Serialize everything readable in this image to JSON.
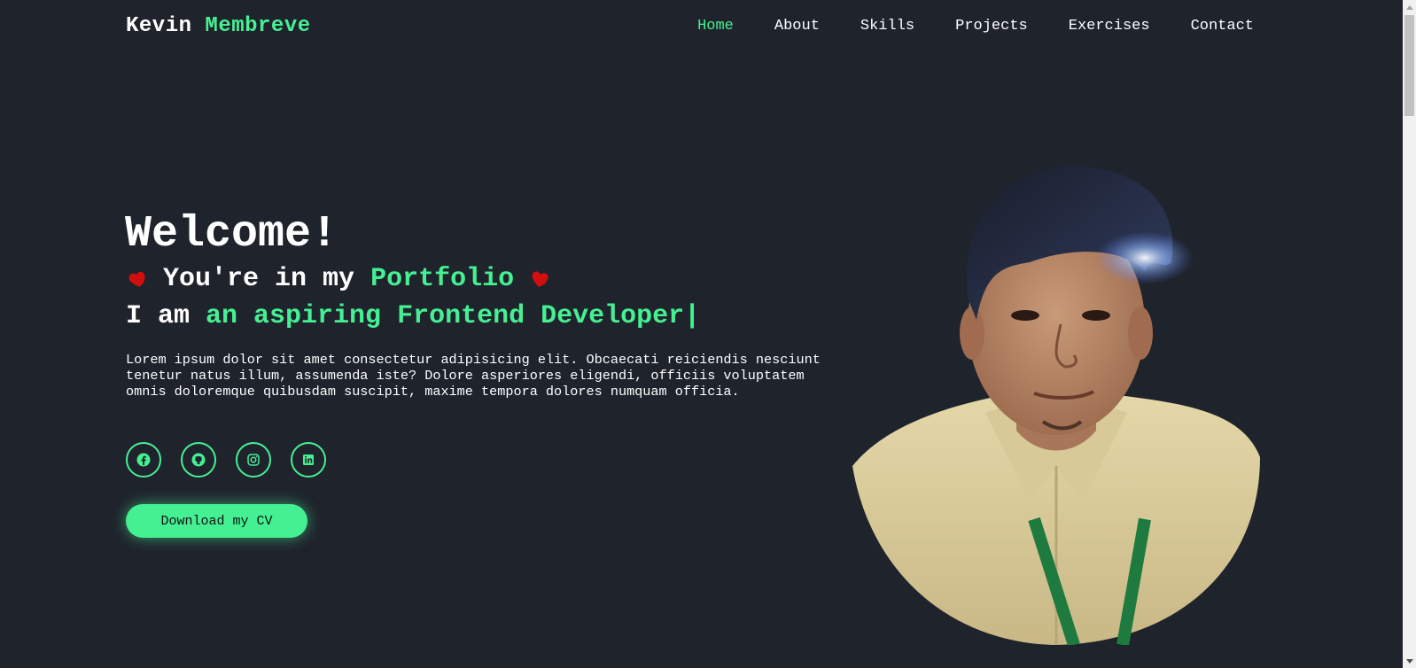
{
  "brand": {
    "first": "Kevin",
    "last": "Membreve"
  },
  "nav": {
    "items": [
      {
        "label": "Home",
        "active": true
      },
      {
        "label": "About",
        "active": false
      },
      {
        "label": "Skills",
        "active": false
      },
      {
        "label": "Projects",
        "active": false
      },
      {
        "label": "Exercises",
        "active": false
      },
      {
        "label": "Contact",
        "active": false
      }
    ]
  },
  "hero": {
    "title": "Welcome!",
    "line2_prefix": "You're in my",
    "line2_accent": "Portfolio",
    "line3_prefix": "I am",
    "line3_accent": "an aspiring Frontend Developer|",
    "description": "Lorem ipsum dolor sit amet consectetur adipisicing elit. Obcaecati reiciendis nesciunt tenetur natus illum, assumenda iste? Dolore asperiores eligendi, officiis voluptatem omnis doloremque quibusdam suscipit, maxime tempora dolores numquam officia.",
    "socials": [
      "facebook-icon",
      "github-icon",
      "instagram-icon",
      "linkedin-icon"
    ],
    "cv_button": "Download my CV"
  },
  "colors": {
    "background": "#1f232c",
    "accent": "#45f093",
    "heart": "#d10f0f",
    "text": "#ffffff"
  }
}
